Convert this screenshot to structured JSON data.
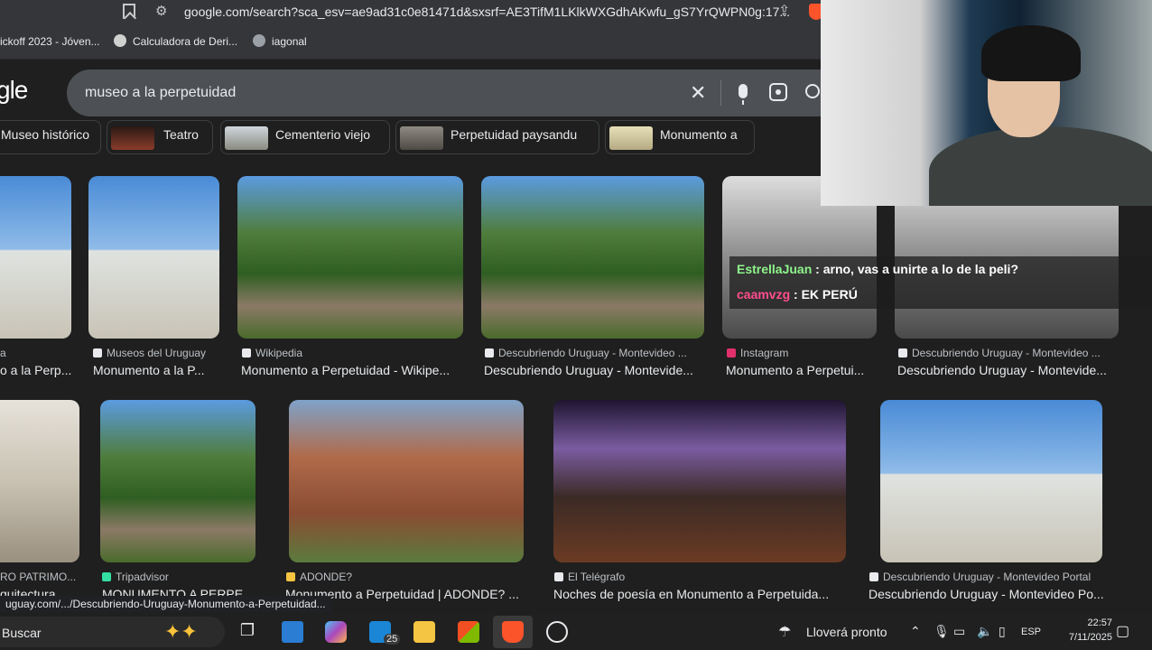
{
  "browser": {
    "url": "google.com/search?sca_esv=ae9ad31c0e81471d&sxsrf=AE3TifM1LKlkWXGdhAKwfu_gS7YrQWPN0g:17...",
    "bookmarks": [
      "ickoff 2023 - Jóven...",
      "Calculadora de Deri...",
      "iagonal"
    ]
  },
  "google": {
    "logo": "gle",
    "query": "museo a la perpetuidad"
  },
  "chips": [
    "Museo histórico",
    "Teatro",
    "Cementerio viejo",
    "Perpetuidad paysandu",
    "Monumento a"
  ],
  "results_row1": [
    {
      "source": "a",
      "title": "o a la Perp..."
    },
    {
      "source": "Museos del Uruguay",
      "title": "Monumento a la P..."
    },
    {
      "source": "Wikipedia",
      "title": "Monumento a Perpetuidad - Wikipe..."
    },
    {
      "source": "Descubriendo Uruguay - Montevideo ...",
      "title": "Descubriendo Uruguay - Montevide..."
    },
    {
      "source": "Instagram",
      "title": "Monumento a Perpetui..."
    },
    {
      "source": "Descubriendo Uruguay - Montevideo ...",
      "title": "Descubriendo Uruguay - Montevide..."
    }
  ],
  "results_row2": [
    {
      "source": "RO PATRIMO...",
      "title": "quitectura..."
    },
    {
      "source": "Tripadvisor",
      "title": "MONUMENTO A PERPE..."
    },
    {
      "source": "ADONDE?",
      "title": "Monumento a Perpetuidad | ADONDE? ..."
    },
    {
      "source": "El Telégrafo",
      "title": "Noches de poesía en Monumento a Perpetuida..."
    },
    {
      "source": "Descubriendo Uruguay - Montevideo Portal",
      "title": "Descubriendo Uruguay - Montevideo Po..."
    }
  ],
  "chat": [
    {
      "user": "EstrellaJuan",
      "color": "#8ef58a",
      "message": ": arno, vas a unirte a lo de la peli?"
    },
    {
      "user": "caamvzg",
      "color": "#ff4d8d",
      "message": ": EK PERÚ"
    }
  ],
  "status_url": "uguay.com/.../Descubriendo-Uruguay-Monumento-a-Perpetuidad...",
  "taskbar": {
    "search_label": "Buscar",
    "mail_badge": "25",
    "weather": "Lloverá pronto",
    "language": "ESP",
    "time": "22:57",
    "date": "7/11/2025"
  }
}
